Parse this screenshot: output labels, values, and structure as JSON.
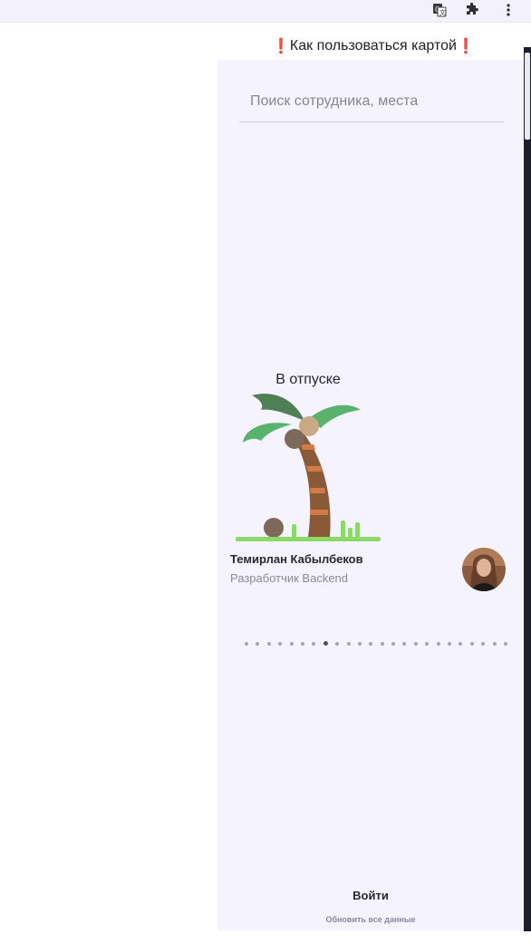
{
  "browser": {
    "icons": [
      "translate-icon",
      "extensions-icon",
      "more-vert-icon"
    ]
  },
  "notice": {
    "text": "Как пользоваться картой",
    "mark": "❗"
  },
  "search": {
    "placeholder": "Поиск сотрудника, места",
    "value": ""
  },
  "employee": {
    "status": "В отпуске",
    "name": "Темирлан Кабылбеков",
    "role": "Разработчик Backend",
    "illustration": "palm-tree-icon"
  },
  "carousel": {
    "count": 24,
    "active_index": 7
  },
  "footer": {
    "login_label": "Войти",
    "refresh_label": "Обновить все данные"
  },
  "colors": {
    "panel_bg": "#f5f3fe",
    "accent_red": "#e1163c",
    "muted_text": "#8d8894"
  }
}
